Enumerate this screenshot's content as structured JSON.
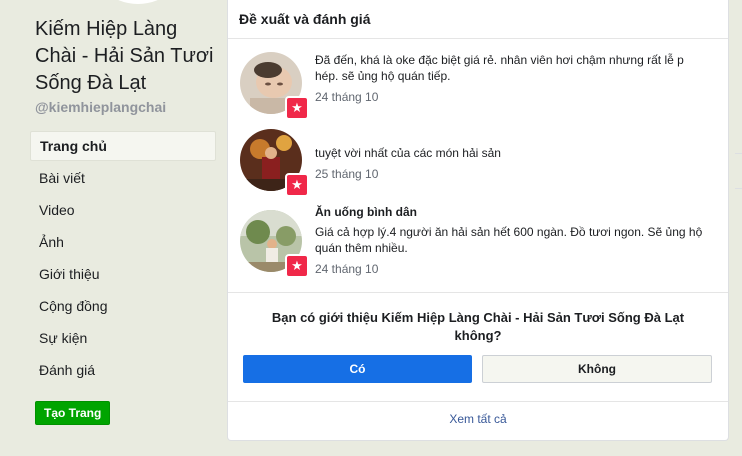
{
  "page": {
    "name": "Kiếm Hiệp Làng Chài - Hải Sản Tươi Sống Đà Lạt",
    "handle": "@kiemhieplangchai"
  },
  "nav": {
    "items": [
      {
        "label": "Trang chủ",
        "active": true
      },
      {
        "label": "Bài viết"
      },
      {
        "label": "Video"
      },
      {
        "label": "Ảnh"
      },
      {
        "label": "Giới thiệu"
      },
      {
        "label": "Cộng đồng"
      },
      {
        "label": "Sự kiện"
      },
      {
        "label": "Đánh giá"
      }
    ],
    "create_page": "Tạo Trang"
  },
  "reviews": {
    "header": "Đề xuất và đánh giá",
    "items": [
      {
        "title": "",
        "text": "Đã đến, khá là oke đặc biệt giá rẻ. nhân viên hơi chậm nhưng rất lễ p hép. sẽ ủng hộ quán tiếp.",
        "date": "24 tháng 10"
      },
      {
        "title": "",
        "text": "tuyệt vời nhất của các món hải sản",
        "date": "25 tháng 10"
      },
      {
        "title": "Ăn uống bình dân",
        "text": "Giá cả hợp lý.4 người ăn hải sản hết 600 ngàn. Đồ tươi ngon. Sẽ ủng hộ quán thêm nhiều.",
        "date": "24 tháng 10"
      }
    ],
    "badge_icon": "star-icon",
    "badge_color": "#f02849"
  },
  "prompt": {
    "question": "Bạn có giới thiệu Kiếm Hiệp Làng Chài - Hải Sản Tươi Sống Đà Lạt không?",
    "yes": "Có",
    "no": "Không"
  },
  "see_all": "Xem tất cả",
  "colors": {
    "background": "#e9ebe0",
    "primary_button": "#166fe5",
    "create_button": "#00a400",
    "link": "#385898"
  }
}
